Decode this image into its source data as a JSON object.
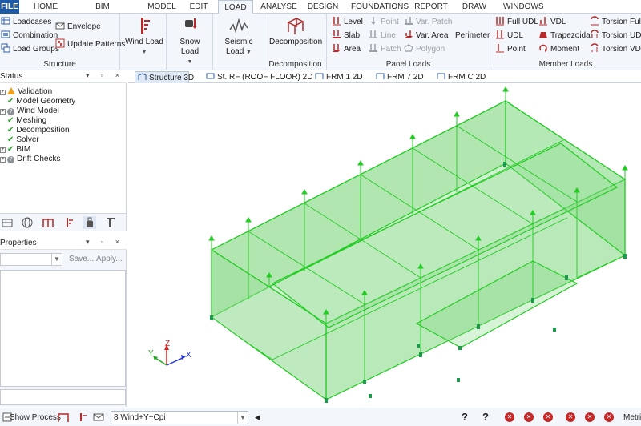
{
  "menu": {
    "tabs": [
      "FILE",
      "HOME",
      "BIM INTEGRATION",
      "MODEL",
      "EDIT",
      "LOAD",
      "ANALYSE",
      "DESIGN",
      "FOUNDATIONS",
      "REPORT",
      "DRAW",
      "WINDOWS"
    ],
    "active": "LOAD"
  },
  "ribbon": {
    "structure": {
      "label": "Structure",
      "loadcases": "Loadcases",
      "combination": "Combination",
      "load_groups": "Load Groups",
      "envelope": "Envelope",
      "update_patterns": "Update Patterns"
    },
    "wind_load": "Wind Load",
    "snow_load": "Snow Load",
    "seismic_load_1": "Seismic",
    "seismic_load_2": "Load",
    "decomposition": {
      "button": "Decomposition",
      "label": "Decomposition"
    },
    "panel_loads": {
      "label": "Panel Loads",
      "level": "Level",
      "slab": "Slab",
      "area": "Area",
      "point": "Point",
      "line": "Line",
      "patch": "Patch",
      "var_patch": "Var. Patch",
      "var_area": "Var. Area",
      "polygon": "Polygon",
      "perimeter": "Perimeter"
    },
    "member_loads": {
      "label": "Member Loads",
      "full_udl": "Full UDL",
      "udl": "UDL",
      "point": "Point",
      "vdl": "VDL",
      "trapezoidal": "Trapezoidal",
      "moment": "Moment",
      "torsion_full": "Torsion Full",
      "torsion_udl": "Torsion UDL",
      "torsion_vdl": "Torsion VDL"
    }
  },
  "status_panel": {
    "title": "Status",
    "buttons": "▾ ▫ ×",
    "items": [
      {
        "label": "Validation",
        "state": "warning"
      },
      {
        "label": "Model Geometry",
        "state": "ok"
      },
      {
        "label": "Wind Model",
        "state": "unknown"
      },
      {
        "label": "Meshing",
        "state": "ok"
      },
      {
        "label": "Decomposition",
        "state": "ok"
      },
      {
        "label": "Solver",
        "state": "ok"
      },
      {
        "label": "BIM",
        "state": "ok"
      },
      {
        "label": "Drift Checks",
        "state": "unknown"
      }
    ]
  },
  "properties_panel": {
    "title": "Properties",
    "buttons": "▾ ▫ ×",
    "save": "Save...",
    "apply": "Apply..."
  },
  "doc_tabs": [
    "Structure 3D",
    "St. RF (ROOF FLOOR) 2D",
    "FRM 1 2D",
    "FRM 7 2D",
    "FRM C 2D"
  ],
  "viewport": {
    "axis_x": "X",
    "axis_y": "Y",
    "axis_z": "Z",
    "colors": {
      "wire": "#22cc22",
      "fill": "#7fd67f",
      "axis_x": "#2233dd",
      "axis_y": "#22aa22",
      "axis_z": "#dd2222",
      "supports": "#1a9a4a"
    }
  },
  "statusbar": {
    "show_process": "Show Process",
    "loadcase": "8 Wind+Y+Cpi",
    "units": "Metric"
  }
}
